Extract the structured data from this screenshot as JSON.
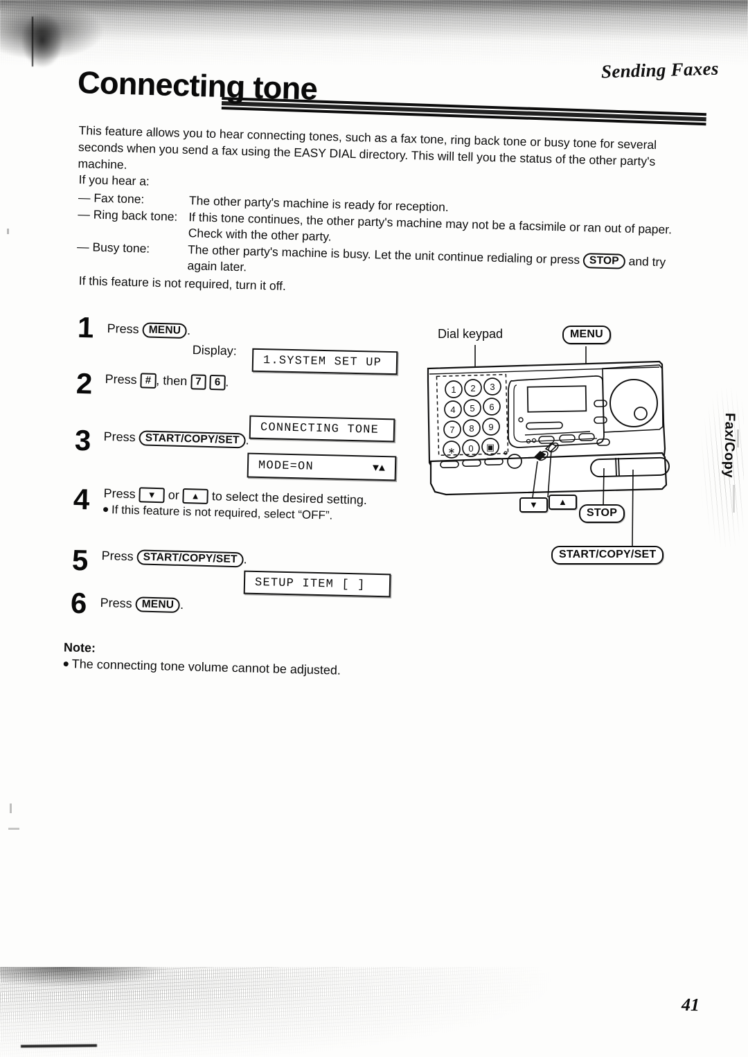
{
  "header": {
    "chapter": "Sending Faxes",
    "title": "Connecting tone"
  },
  "intro": {
    "line1": "This feature allows you to hear connecting tones, such as a fax tone, ring back tone or busy tone for several",
    "line2": "seconds when you send a fax using the EASY DIAL directory. This will tell you the status of the other party's",
    "line3": "machine."
  },
  "tones": {
    "intro": "If you hear a:",
    "items": [
      {
        "label": "— Fax tone:",
        "lines": [
          "The other party's machine is ready for reception."
        ]
      },
      {
        "label": "— Ring back tone:",
        "lines": [
          "If this tone continues, the other party's machine may not be a facsimile or ran out of paper.",
          "Check with the other party."
        ]
      },
      {
        "label": "— Busy tone:",
        "lines": [
          "The other party's machine is busy. Let the unit continue redialing or press",
          "again later."
        ],
        "inline_key": "STOP",
        "after_key": "and try"
      }
    ],
    "footer": "If this feature is not required, turn it off."
  },
  "steps": [
    {
      "number": "1",
      "press_word": "Press",
      "key": "MENU",
      "period": "."
    },
    {
      "number": "2",
      "press_word": "Press",
      "key1": "#",
      "mid": ", then",
      "key2": "7",
      "key3": "6",
      "period": "."
    },
    {
      "number": "3",
      "press_word": "Press",
      "key": "START/COPY/SET",
      "period": "."
    },
    {
      "number": "4",
      "press_word": "Press",
      "key_down": "▼",
      "or_word": "or",
      "key_up": "▲",
      "tail": "to select the desired setting.",
      "sub": "If this feature is not required, select “OFF”."
    },
    {
      "number": "5",
      "press_word": "Press",
      "key": "START/COPY/SET",
      "period": "."
    },
    {
      "number": "6",
      "press_word": "Press",
      "key": "MENU",
      "period": "."
    }
  ],
  "display_caption": "Display:",
  "lcd": {
    "screen1": "1.SYSTEM SET UP",
    "screen2": "CONNECTING TONE",
    "screen3_left": "MODE=ON",
    "screen3_right": "▼▲",
    "screen4": "SETUP ITEM [    ]"
  },
  "diagram": {
    "keypad_label": "Dial keypad",
    "menu_callout": "MENU",
    "down_callout": "▼",
    "up_callout": "▲",
    "stop_callout": "STOP",
    "start_callout": "START/COPY/SET",
    "keypad_keys": [
      "1",
      "2",
      "3",
      "4",
      "5",
      "6",
      "7",
      "8",
      "9",
      "∗",
      "0",
      "▣"
    ]
  },
  "side_tab": "Fax/Copy",
  "note": {
    "heading": "Note:",
    "bullet": "The connecting tone volume cannot be adjusted."
  },
  "page_number": "41"
}
